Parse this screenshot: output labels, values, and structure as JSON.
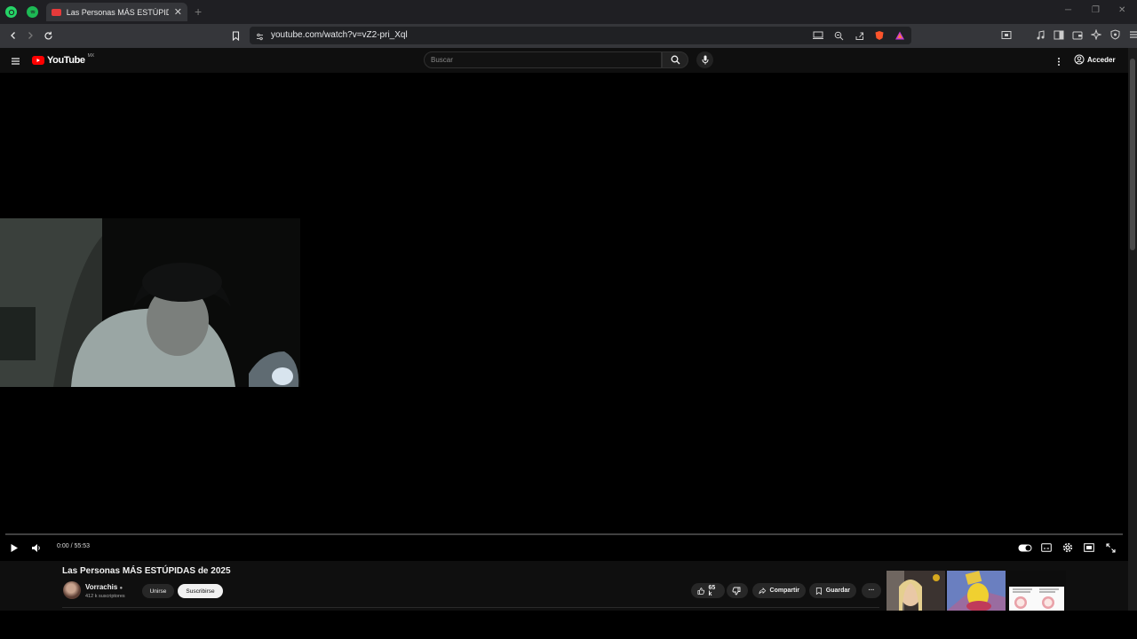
{
  "browser": {
    "tab_title": "Las Personas MÁS ESTÚPIDAS de",
    "new_tab": "+",
    "tab_close": "✕",
    "url": "youtube.com/watch?v=vZ2-pri_Xql"
  },
  "youtube": {
    "logo_text": "YouTube",
    "country": "MX",
    "search_placeholder": "Buscar",
    "sign_in": "Acceder"
  },
  "player": {
    "time": "0:00 / 55:53",
    "progress": 0.0
  },
  "video": {
    "title": "Las Personas MÁS ESTÚPIDAS de 2025",
    "channel": "Vorrachis",
    "subscribers": "412 k suscriptores",
    "join": "Unirse",
    "subscribe": "Suscribirse",
    "likes": "65 k",
    "share": "Compartir",
    "save": "Guardar",
    "more": "···"
  },
  "colors": {
    "brand_red": "#ff0000",
    "background": "#0f0f0f"
  }
}
